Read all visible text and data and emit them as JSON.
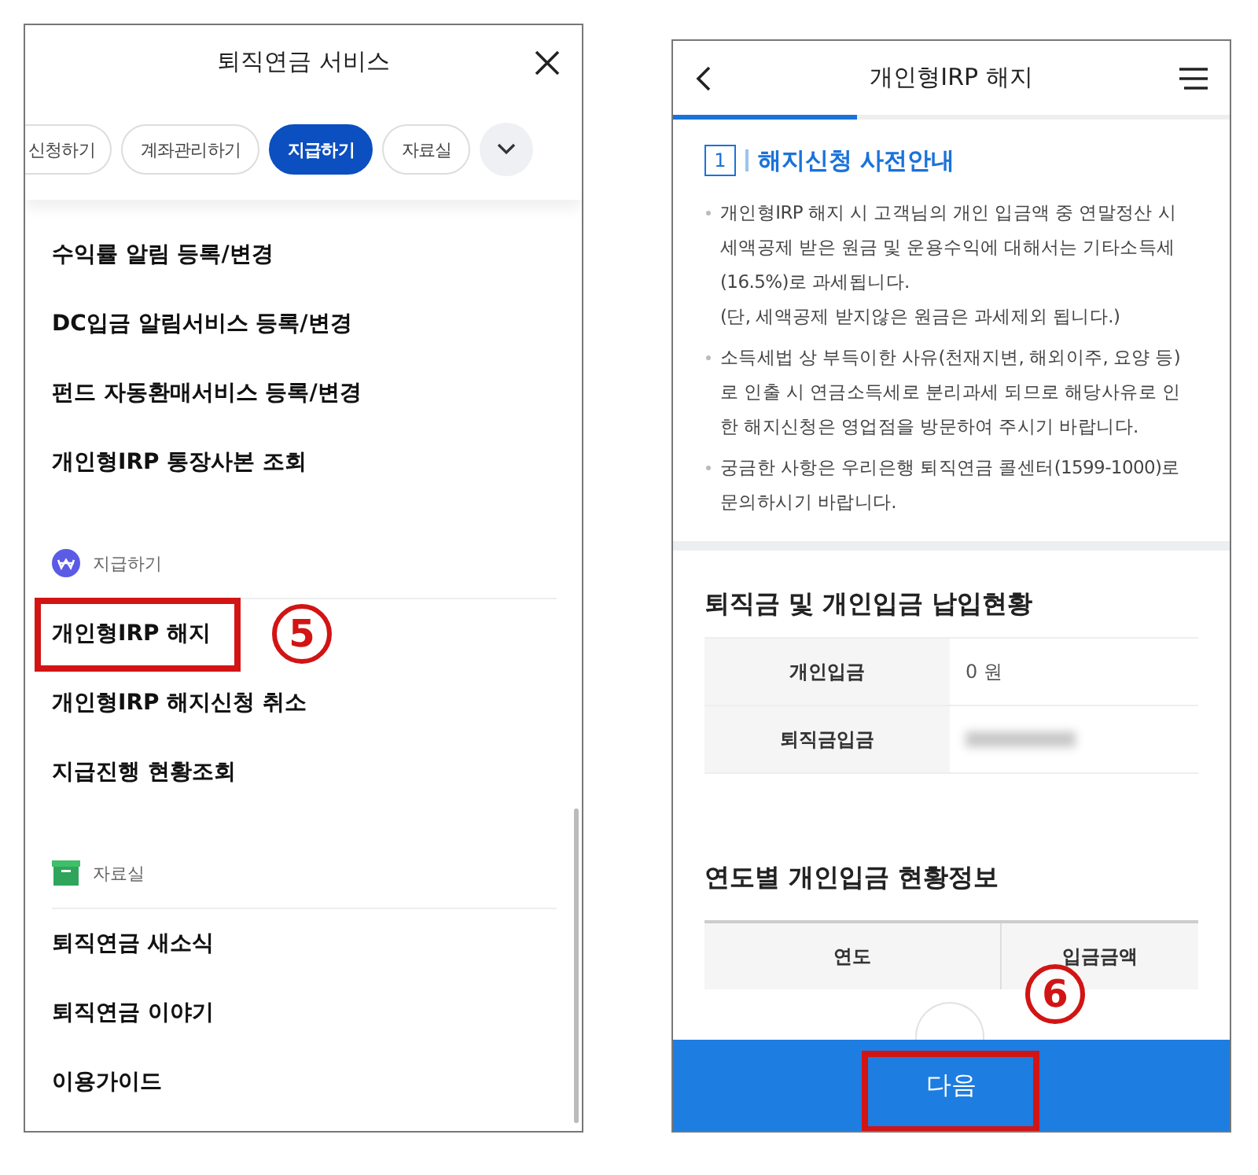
{
  "menu_screen": {
    "title": "퇴직연금 서비스",
    "chips": [
      {
        "label": "신청하기",
        "selected": false,
        "kind": "cut"
      },
      {
        "label": "계좌관리하기",
        "selected": false,
        "kind": "full"
      },
      {
        "label": "지급하기",
        "selected": true,
        "kind": "full"
      },
      {
        "label": "자료실",
        "selected": false,
        "kind": "full"
      }
    ],
    "sections": [
      {
        "items": [
          {
            "label": "수익률 알림 등록/변경"
          },
          {
            "label": "DC입금 알림서비스 등록/변경"
          },
          {
            "label": "펀드 자동환매서비스 등록/변경"
          },
          {
            "label": "개인형IRP 통장사본 조회"
          }
        ]
      },
      {
        "header": "지급하기",
        "kind": "won",
        "items": [
          {
            "label": "개인형IRP 해지",
            "step": "5"
          },
          {
            "label": "개인형IRP 해지신청 취소"
          },
          {
            "label": "지급진행 현황조회"
          }
        ]
      },
      {
        "header": "자료실",
        "kind": "box",
        "items": [
          {
            "label": "퇴직연금 새소식"
          },
          {
            "label": "퇴직연금 이야기"
          },
          {
            "label": "이용가이드"
          }
        ]
      }
    ]
  },
  "cancel_screen": {
    "title": "개인형IRP 해지",
    "progress": {
      "level": 0.33
    },
    "step": {
      "number": "1",
      "title": "해지신청 사전안내"
    },
    "notes": [
      "개인형IRP 해지 시 고객님의 개인 입금액 중 연말정산 시 세액공제 받은 원금 및 운용수익에 대해서는 기타소득세 (16.5%)로 과세됩니다.\n(단, 세액공제 받지않은 원금은 과세제외 됩니다.)",
      "소득세법 상 부득이한 사유(천재지변, 해외이주, 요양 등)로 인출 시 연금소득세로 분리과세 되므로 해당사유로 인한 해지신청은 영업점을 방문하여 주시기 바랍니다.",
      "궁금한 사항은 우리은행 퇴직연금 콜센터(1599-1000)로 문의하시기 바랍니다."
    ],
    "deposit_status": {
      "title": "퇴직금 및 개인입금 납입현황",
      "rows": [
        {
          "label": "개인입금",
          "value": "0 원",
          "redacted": false
        },
        {
          "label": "퇴직금입금",
          "redacted": true
        }
      ]
    },
    "yearly": {
      "title": "연도별 개인입금 현황정보",
      "columns": [
        "연도",
        "입금금액"
      ]
    },
    "next_button": {
      "label": "다음",
      "step": "6"
    }
  }
}
